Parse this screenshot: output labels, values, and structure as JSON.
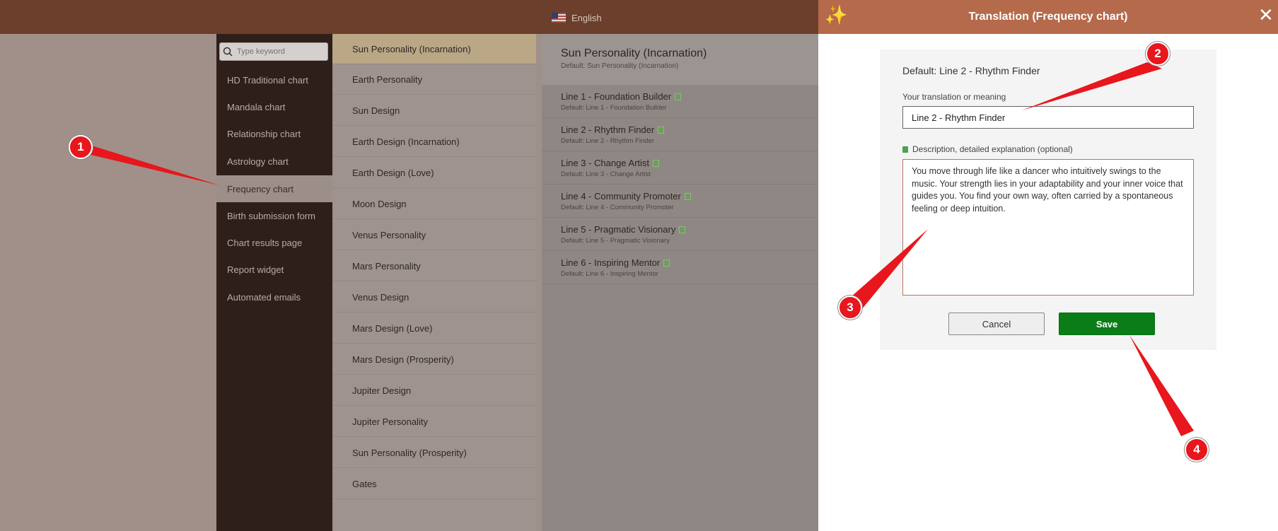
{
  "header": {
    "language": "English",
    "flag_icon": "us-flag-icon"
  },
  "sidebar": {
    "search_placeholder": "Type keyword",
    "items": [
      {
        "label": "HD Traditional chart"
      },
      {
        "label": "Mandala chart"
      },
      {
        "label": "Relationship chart"
      },
      {
        "label": "Astrology chart"
      },
      {
        "label": "Frequency chart",
        "active": true
      },
      {
        "label": "Birth submission form"
      },
      {
        "label": "Chart results page"
      },
      {
        "label": "Report widget"
      },
      {
        "label": "Automated emails"
      }
    ]
  },
  "middle": {
    "items": [
      {
        "label": "Sun Personality (Incarnation)",
        "active": true
      },
      {
        "label": "Earth Personality"
      },
      {
        "label": "Sun Design"
      },
      {
        "label": "Earth Design (Incarnation)"
      },
      {
        "label": "Earth Design (Love)"
      },
      {
        "label": "Moon Design"
      },
      {
        "label": "Venus Personality"
      },
      {
        "label": "Mars Personality"
      },
      {
        "label": "Venus Design"
      },
      {
        "label": "Mars Design (Love)"
      },
      {
        "label": "Mars Design (Prosperity)"
      },
      {
        "label": "Jupiter Design"
      },
      {
        "label": "Jupiter Personality"
      },
      {
        "label": "Sun Personality (Prosperity)"
      },
      {
        "label": "Gates"
      }
    ]
  },
  "detail": {
    "title": "Sun Personality (Incarnation)",
    "default": "Default: Sun Personality (Incarnation)",
    "lines": [
      {
        "title": "Line 1 - Foundation Builder",
        "default": "Default: Line 1 - Foundation Builder"
      },
      {
        "title": "Line 2 - Rhythm Finder",
        "default": "Default: Line 2 - Rhythm Finder"
      },
      {
        "title": "Line 3 - Change Artist",
        "default": "Default: Line 3 - Change Artist"
      },
      {
        "title": "Line 4 - Community Promoter",
        "default": "Default: Line 4 - Community Promoter"
      },
      {
        "title": "Line 5 - Pragmatic Visionary",
        "default": "Default: Line 5 - Pragmatic Visionary"
      },
      {
        "title": "Line 6 - Inspiring Mentor",
        "default": "Default: Line 6 - Inspiring Mentor"
      }
    ]
  },
  "panel": {
    "title": "Translation (Frequency chart)",
    "sparkle_icon": "✨",
    "close_icon": "✕",
    "default_text": "Default: Line 2 - Rhythm Finder",
    "translation_label": "Your translation or meaning",
    "translation_value": "Line 2 - Rhythm Finder",
    "description_label": "Description, detailed explanation (optional)",
    "description_value": "You move through life like a dancer who intuitively swings to the music. Your strength lies in your adaptability and your inner voice that guides you. You find your own way, often carried by a spontaneous feeling or deep intuition.",
    "cancel_label": "Cancel",
    "save_label": "Save"
  },
  "annotations": {
    "b1": "1",
    "b2": "2",
    "b3": "3",
    "b4": "4"
  },
  "colors": {
    "accent": "#b56a4b",
    "save": "#0b7d17",
    "badge": "#e8161d"
  }
}
